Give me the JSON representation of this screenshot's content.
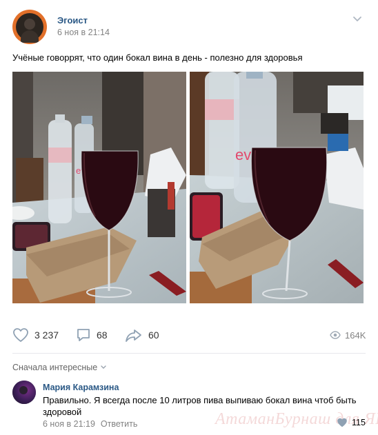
{
  "post": {
    "author": "Эгоист",
    "date": "6 ноя в 21:14",
    "text": "Учёные говоррят, что один бокал вина в день - полезно для здоровья",
    "photos": [
      {
        "bottle_label": "evian"
      },
      {
        "bottle_label": "evian"
      }
    ]
  },
  "actions": {
    "likes": "3 237",
    "comments": "68",
    "shares": "60",
    "views": "164K"
  },
  "comments_section": {
    "sort_label": "Сначала интересные",
    "items": [
      {
        "author": "Мария Карамзина",
        "text": "Правильно. Я всегда после 10 литров пива выпиваю бокал вина чтоб быть здоровой",
        "date": "6 ноя в 21:19",
        "reply_label": "Ответить",
        "likes": "115"
      }
    ]
  },
  "watermark": "АтаманБурнаш для ЯП",
  "colors": {
    "link": "#2a5885",
    "meta": "#828282",
    "wine": "#2a0a12"
  }
}
